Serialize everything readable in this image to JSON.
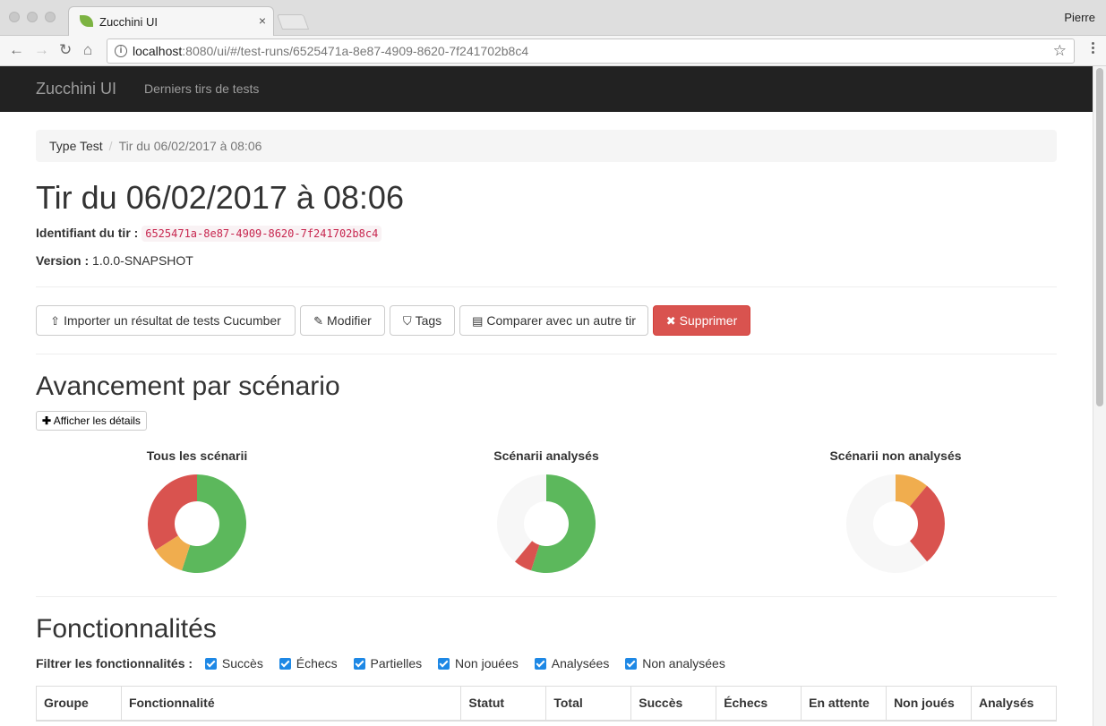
{
  "browser": {
    "tab_title": "Zucchini UI",
    "tab_close": "×",
    "user": "Pierre",
    "url_host": "localhost",
    "url_rest": ":8080/ui/#/test-runs/6525471a-8e87-4909-8620-7f241702b8c4"
  },
  "navbar": {
    "brand": "Zucchini UI",
    "link": "Derniers tirs de tests"
  },
  "breadcrumb": {
    "root": "Type Test",
    "current": "Tir du 06/02/2017 à 08:06"
  },
  "page": {
    "title": "Tir du 06/02/2017 à 08:06",
    "id_label": "Identifiant du tir :",
    "id_value": "6525471a-8e87-4909-8620-7f241702b8c4",
    "version_label": "Version :",
    "version_value": "1.0.0-SNAPSHOT"
  },
  "actions": {
    "import": "Importer un résultat de tests Cucumber",
    "edit": "Modifier",
    "tags": "Tags",
    "compare": "Comparer avec un autre tir",
    "delete": "Supprimer"
  },
  "progress": {
    "title": "Avancement par scénario",
    "details_button": "Afficher les détails",
    "charts": [
      {
        "title": "Tous les scénarii",
        "slices": [
          {
            "color": "#5cb85c",
            "value": 55
          },
          {
            "color": "#f0ad4e",
            "value": 11
          },
          {
            "color": "#d9534f",
            "value": 34
          }
        ]
      },
      {
        "title": "Scénarii analysés",
        "slices": [
          {
            "color": "#5cb85c",
            "value": 55
          },
          {
            "color": "#d9534f",
            "value": 6
          },
          {
            "color": "#f7f7f7",
            "value": 39
          }
        ]
      },
      {
        "title": "Scénarii non analysés",
        "slices": [
          {
            "color": "#f0ad4e",
            "value": 11
          },
          {
            "color": "#d9534f",
            "value": 28
          },
          {
            "color": "#f7f7f7",
            "value": 61
          }
        ]
      }
    ]
  },
  "features": {
    "title": "Fonctionnalités",
    "filter_label": "Filtrer les fonctionnalités :",
    "filters": [
      "Succès",
      "Échecs",
      "Partielles",
      "Non jouées",
      "Analysées",
      "Non analysées"
    ],
    "columns": [
      "Groupe",
      "Fonctionnalité",
      "Statut",
      "Total",
      "Succès",
      "Échecs",
      "En attente",
      "Non joués",
      "Analysés"
    ]
  }
}
